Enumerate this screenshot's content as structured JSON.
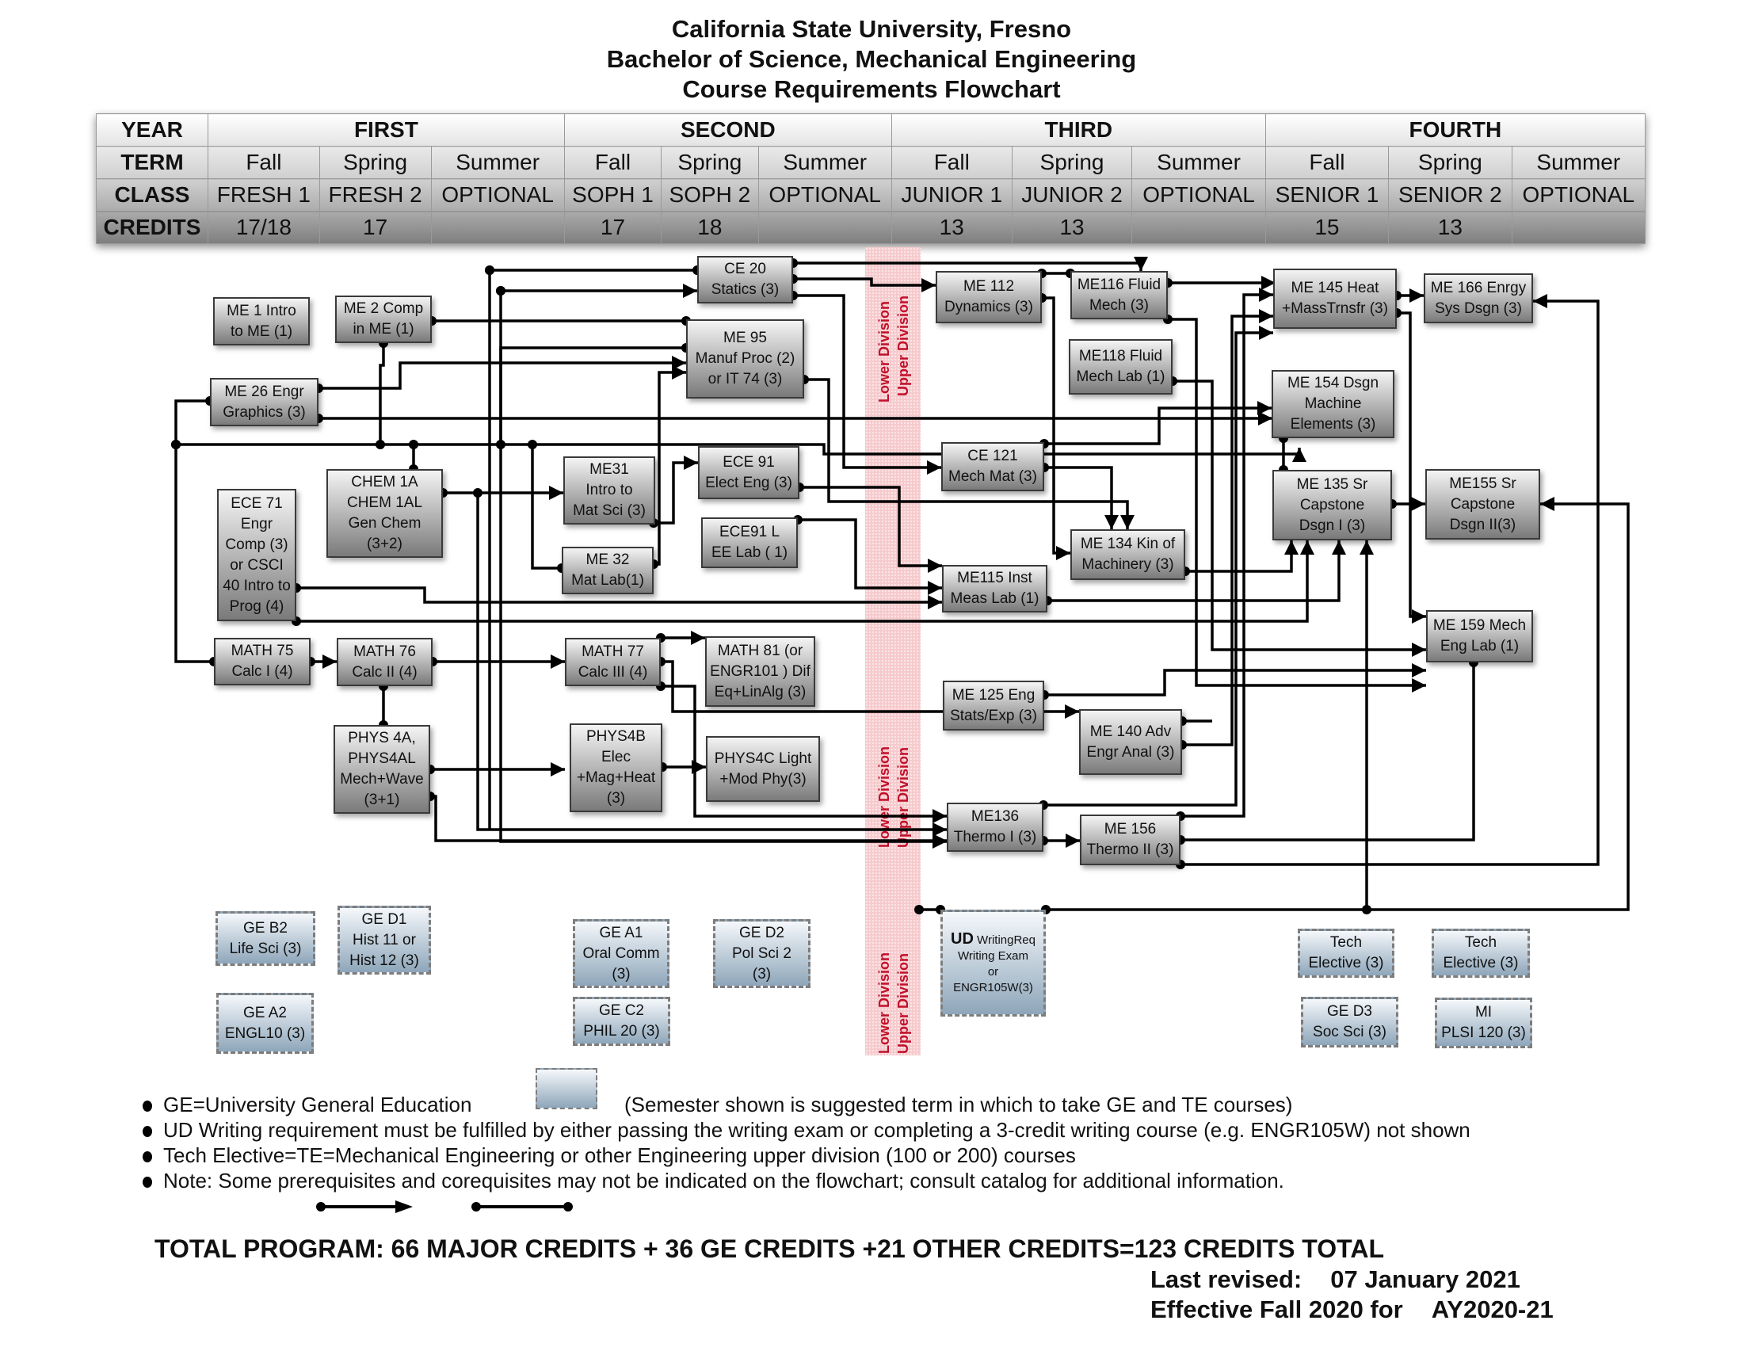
{
  "header": {
    "title_lines": [
      "California State University, Fresno",
      "Bachelor of Science, Mechanical Engineering",
      "Course Requirements Flowchart"
    ]
  },
  "schedule": {
    "row_labels": [
      "YEAR",
      "TERM",
      "CLASS",
      "CREDITS"
    ],
    "years": [
      "FIRST",
      "SECOND",
      "THIRD",
      "FOURTH"
    ],
    "terms": [
      "Fall",
      "Spring",
      "Summer",
      "Fall",
      "Spring",
      "Summer",
      "Fall",
      "Spring",
      "Summer",
      "Fall",
      "Spring",
      "Summer"
    ],
    "classes": [
      "FRESH 1",
      "FRESH 2",
      "OPTIONAL",
      "SOPH 1",
      "SOPH 2",
      "OPTIONAL",
      "JUNIOR 1",
      "JUNIOR 2",
      "OPTIONAL",
      "SENIOR 1",
      "SENIOR 2",
      "OPTIONAL"
    ],
    "credits": [
      "17/18",
      "17",
      "",
      "17",
      "18",
      "",
      "13",
      "13",
      "",
      "15",
      "13",
      ""
    ]
  },
  "division_labels": {
    "lower": "Lower Division",
    "upper": "Upper Division"
  },
  "courses": {
    "me1": "ME 1 Intro\nto ME (1)",
    "me2": "ME 2 Comp\nin ME  (1)",
    "me26": "ME 26 Engr\nGraphics (3)",
    "chem1a": "CHEM 1A\nCHEM 1AL\nGen Chem\n(3+2)",
    "ece71": "ECE 71\nEngr\nComp (3)\nor CSCI\n40 Intro to\nProg (4)",
    "math75": "MATH 75\nCalc I (4)",
    "math76": "MATH 76\nCalc II (4)",
    "phys4a": "PHYS 4A,\nPHYS4AL\nMech+Wave\n(3+1)",
    "ce20": "CE 20\nStatics (3)",
    "me95": "ME 95\nManuf Proc (2)\nor IT 74 (3)",
    "me31": "ME31\nIntro to\nMat Sci (3)",
    "me32": "ME 32\nMat Lab(1)",
    "ece91": "ECE 91\nElect Eng (3)",
    "ece91l": "ECE91 L\nEE Lab ( 1)",
    "math77": "MATH 77\nCalc III (4)",
    "math81": "MATH 81 (or\nENGR101 ) Dif\nEq+LinAlg (3)",
    "phys4b": "PHYS4B\nElec\n+Mag+Heat\n(3)",
    "phys4c": "PHYS4C Light\n+Mod Phy(3)",
    "me112": "ME 112\nDynamics (3)",
    "me116": "ME116 Fluid\nMech (3)",
    "me118": "ME118 Fluid\nMech Lab (1)",
    "ce121": "CE 121\nMech Mat (3)",
    "me134": "ME 134 Kin of\nMachinery  (3)",
    "me115": "ME115 Inst\nMeas Lab (1)",
    "me125": "ME 125  Eng\nStats/Exp (3)",
    "me140": "ME 140 Adv\nEngr Anal (3)",
    "me136": "ME136\nThermo I (3)",
    "me156": "ME 156\nThermo II (3)",
    "me145": "ME 145 Heat\n+MassTrnsfr (3)",
    "me166": "ME 166 Enrgy\nSys Dsgn (3)",
    "me154": "ME 154 Dsgn\nMachine\nElements (3)",
    "me135": "ME 135 Sr\nCapstone\nDsgn I (3)",
    "me155": "ME155 Sr\nCapstone\nDsgn II(3)",
    "me159": "ME 159 Mech\nEng Lab  (1)"
  },
  "ge_courses": {
    "geb2": "GE B2\nLife Sci (3)",
    "ged1": "GE D1\nHist 11 or\nHist 12 (3)",
    "gea2": "GE A2\nENGL10 (3)",
    "gea1": "GE A1\nOral Comm\n(3)",
    "gec2": "GE C2\nPHIL 20 (3)",
    "ged2": "GE D2\nPol Sci 2\n(3)",
    "te1": "Tech\nElective (3)",
    "te2": "Tech\nElective (3)",
    "ged3": "GE D3\nSoc Sci (3)",
    "mi": "MI\nPLSI 120 (3)"
  },
  "ud_writing": {
    "bold": "UD",
    "rest": " WritingReq\nWriting Exam\nor\nENGR105W(3)"
  },
  "legend": {
    "items": [
      "GE=University General Education",
      "UD Writing requirement must be fulfilled by either passing the writing exam or completing a 3-credit writing course (e.g.   ENGR105W) not shown",
      "Tech Elective=TE=Mechanical Engineering or other Engineering upper division (100 or 200) courses",
      "Note: Some prerequisites and  corequisites may not be indicated on the flowchart; consult catalog for additional information."
    ],
    "ge_note": "(Semester shown is suggested term in which to take GE and TE courses)",
    "symbols": [
      "prerequisite-arrow",
      "corequisite-line"
    ]
  },
  "footer": {
    "total": "TOTAL PROGRAM: 66 MAJOR CREDITS + 36 GE CREDITS +21 OTHER CREDITS=123 CREDITS TOTAL",
    "last_revised_label": "Last revised:",
    "last_revised_date": "07 January 2021",
    "effective_label": "Effective Fall 2020 for",
    "effective_year": "AY2020-21"
  }
}
